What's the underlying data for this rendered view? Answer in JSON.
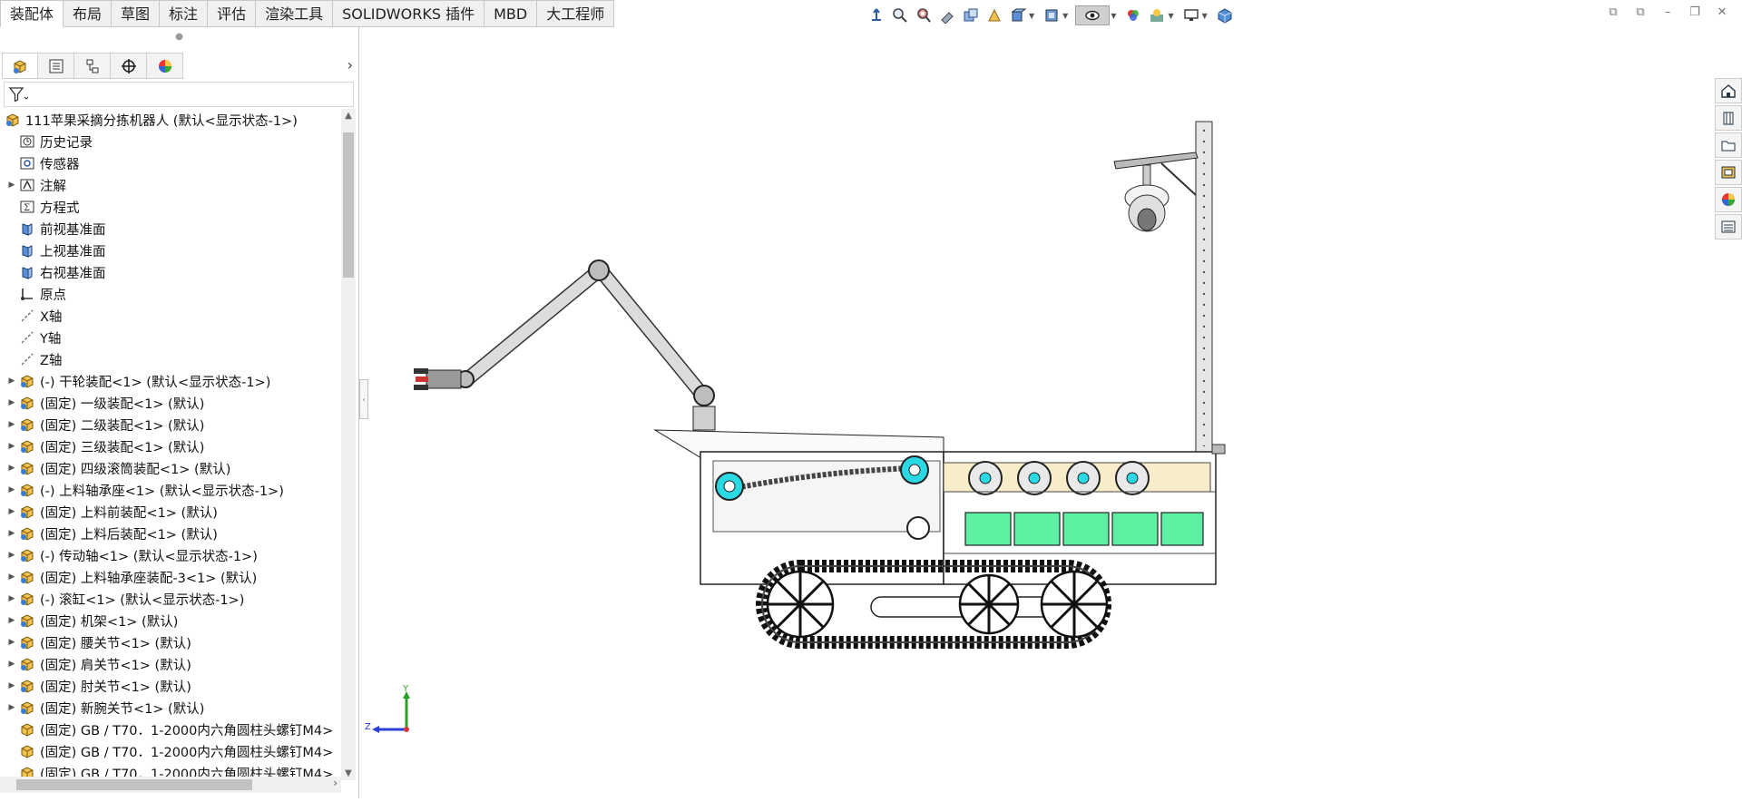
{
  "command_tabs": [
    "装配体",
    "布局",
    "草图",
    "标注",
    "评估",
    "渲染工具",
    "SOLIDWORKS 插件",
    "MBD",
    "大工程师"
  ],
  "heads_up_icons": [
    "view-orientation-icon",
    "zoom-to-fit-icon",
    "zoom-area-icon",
    "previous-view-icon",
    "section-view-icon",
    "dynamic-annotation-icon",
    "view-orientation-box-icon",
    "display-style-icon",
    "hide-show-icon",
    "edit-appearance-icon",
    "apply-scene-icon",
    "view-settings-icon",
    "3d-view-icon"
  ],
  "manager_tabs": [
    "featuremanager-icon",
    "propertymanager-icon",
    "configurationmanager-icon",
    "dimxpert-icon",
    "display-manager-icon"
  ],
  "tree": {
    "root": "111苹果采摘分拣机器人 (默认<显示状态-1>)",
    "items": [
      {
        "label": "历史记录",
        "icon": "history-icon",
        "expand": false
      },
      {
        "label": "传感器",
        "icon": "sensor-icon",
        "expand": false
      },
      {
        "label": "注解",
        "icon": "annotation-icon",
        "expand": true
      },
      {
        "label": "方程式",
        "icon": "equation-icon",
        "expand": false
      },
      {
        "label": "前视基准面",
        "icon": "plane-icon",
        "expand": false
      },
      {
        "label": "上视基准面",
        "icon": "plane-icon",
        "expand": false
      },
      {
        "label": "右视基准面",
        "icon": "plane-icon",
        "expand": false
      },
      {
        "label": "原点",
        "icon": "origin-icon",
        "expand": false
      },
      {
        "label": "X轴",
        "icon": "axis-icon",
        "expand": false
      },
      {
        "label": "Y轴",
        "icon": "axis-icon",
        "expand": false
      },
      {
        "label": "Z轴",
        "icon": "axis-icon",
        "expand": false
      },
      {
        "label": "(-) 干轮装配<1> (默认<显示状态-1>)",
        "icon": "subassembly-icon",
        "expand": true
      },
      {
        "label": "(固定) 一级装配<1> (默认)",
        "icon": "subassembly-icon",
        "expand": true
      },
      {
        "label": "(固定) 二级装配<1> (默认)",
        "icon": "subassembly-icon",
        "expand": true
      },
      {
        "label": "(固定) 三级装配<1> (默认)",
        "icon": "subassembly-icon",
        "expand": true
      },
      {
        "label": "(固定) 四级滚筒装配<1> (默认)",
        "icon": "subassembly-icon",
        "expand": true
      },
      {
        "label": "(-) 上料轴承座<1> (默认<显示状态-1>)",
        "icon": "subassembly-icon",
        "expand": true
      },
      {
        "label": "(固定) 上料前装配<1> (默认)",
        "icon": "subassembly-icon",
        "expand": true
      },
      {
        "label": "(固定) 上料后装配<1> (默认)",
        "icon": "subassembly-icon",
        "expand": true
      },
      {
        "label": "(-) 传动轴<1> (默认<显示状态-1>)",
        "icon": "subassembly-icon",
        "expand": true
      },
      {
        "label": "(固定) 上料轴承座装配-3<1> (默认)",
        "icon": "subassembly-icon",
        "expand": true
      },
      {
        "label": "(-) 滚缸<1> (默认<显示状态-1>)",
        "icon": "subassembly-icon",
        "expand": true
      },
      {
        "label": "(固定) 机架<1> (默认)",
        "icon": "subassembly-icon",
        "expand": true
      },
      {
        "label": "(固定) 腰关节<1> (默认)",
        "icon": "subassembly-icon",
        "expand": true
      },
      {
        "label": "(固定) 肩关节<1> (默认)",
        "icon": "subassembly-icon",
        "expand": true
      },
      {
        "label": "(固定) 肘关节<1> (默认)",
        "icon": "subassembly-icon",
        "expand": true
      },
      {
        "label": "(固定) 新腕关节<1> (默认)",
        "icon": "subassembly-icon",
        "expand": true
      },
      {
        "label": "(固定) GB / T70．1-2000内六角圆柱头螺钉M4>",
        "icon": "part-icon",
        "expand": false
      },
      {
        "label": "(固定) GB / T70．1-2000内六角圆柱头螺钉M4>",
        "icon": "part-icon",
        "expand": false
      },
      {
        "label": "(固定) GB / T70．1-2000内六角圆柱头螺钉M4>",
        "icon": "part-icon",
        "expand": false
      }
    ]
  },
  "triad": {
    "y": "Y",
    "z": "Z"
  },
  "task_pane_icons": [
    "home-icon",
    "design-library-icon",
    "file-explorer-icon",
    "view-palette-icon",
    "appearances-icon",
    "custom-properties-icon"
  ],
  "colors": {
    "accent_cyan": "#2ad9e4",
    "accent_green": "#5ef0a3",
    "panel_beige": "#f7edc8"
  }
}
